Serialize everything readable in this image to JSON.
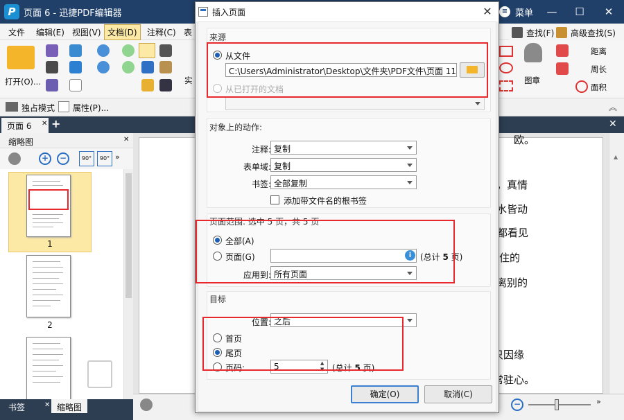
{
  "app": {
    "title": "页面 6 - 迅捷PDF编辑器",
    "logo": "P",
    "menu_label": "菜单",
    "window_buttons": {
      "minimize": "—",
      "maximize": "☐",
      "close": "✕"
    }
  },
  "menubar": [
    "文件",
    "编辑(E)",
    "视图(V)",
    "文档(D)",
    "注释(C)",
    "表"
  ],
  "ribbon": {
    "open_label": "打开(O)...",
    "partial_label": "实",
    "find_label": "查找(F)",
    "adv_find_label": "高级查找(S)",
    "stamp_label": "图章",
    "distance_label": "距离",
    "perimeter_label": "周长",
    "area_label": "面积"
  },
  "toolbar2": {
    "exclusive_mode": "独占模式",
    "properties": "属性(P)..."
  },
  "doc_tab": {
    "label": "页面 6",
    "close": "✕",
    "add": "+"
  },
  "left_panel": {
    "title": "缩略图",
    "close": "✕",
    "thumbs": [
      "1",
      "2"
    ]
  },
  "bottom_tabs": {
    "bookmark": "书签",
    "thumbnail": "缩略图",
    "close": "✕"
  },
  "doc_text": {
    "line0": "欧。",
    "line1": "令，真情",
    "line2": "山水皆动",
    "line3": "都看见",
    "line4": "留住的",
    "line5": "了离别的",
    "line6": "只因缘",
    "line7": "常驻心。"
  },
  "dialog": {
    "title": "插入页面",
    "close": "✕",
    "source": {
      "label": "来源",
      "from_file": "从文件",
      "file_path": "C:\\Users\\Administrator\\Desktop\\文件夹\\PDF文件\\页面 11.pdf",
      "from_open_doc": "从已打开的文档",
      "open_doc_value": ""
    },
    "actions": {
      "label": "对象上的动作:",
      "annot_label": "注释:",
      "annot_value": "复制",
      "form_label": "表单域:",
      "form_value": "复制",
      "bookmark_label": "书签:",
      "bookmark_value": "全部复制",
      "add_root_bookmark": "添加带文件名的根书签"
    },
    "range": {
      "label": "页面范围: 选中 5 页，共 5 页",
      "all": "全部(A)",
      "pages": "页面(G)",
      "pages_value": "",
      "total_prefix": "(总计 ",
      "total_count": "5",
      "total_suffix": " 页)",
      "apply_label": "应用到:",
      "apply_value": "所有页面"
    },
    "target": {
      "label": "目标",
      "position_label": "位置:",
      "position_value": "之后",
      "first": "首页",
      "last": "尾页",
      "page_num": "页码:",
      "page_num_value": "5",
      "total_prefix": "(总计 ",
      "total_count": "5",
      "total_suffix": " 页)"
    },
    "ok": "确定(O)",
    "cancel": "取消(C)"
  },
  "colors": {
    "title_bar": "#20406a",
    "accent": "#1a5fb4",
    "highlight": "#e8282c"
  }
}
